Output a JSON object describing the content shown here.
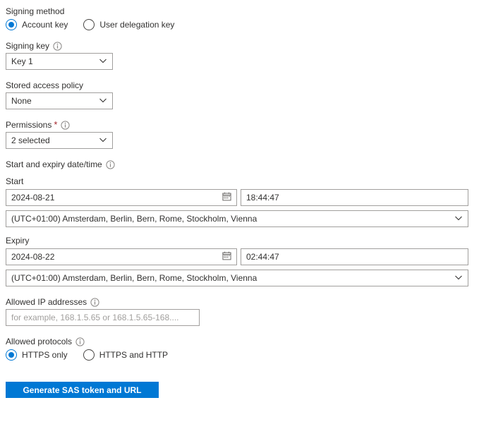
{
  "form": {
    "signing_method": {
      "label": "Signing method",
      "options": [
        {
          "label": "Account key",
          "selected": true
        },
        {
          "label": "User delegation key",
          "selected": false
        }
      ]
    },
    "signing_key": {
      "label": "Signing key",
      "value": "Key 1",
      "has_info": true
    },
    "stored_access_policy": {
      "label": "Stored access policy",
      "value": "None",
      "has_info": false
    },
    "permissions": {
      "label": "Permissions",
      "required_marker": "*",
      "value": "2 selected",
      "has_info": true
    },
    "date_time": {
      "label": "Start and expiry date/time",
      "has_info": true,
      "start": {
        "label": "Start",
        "date": "2024-08-21",
        "time": "18:44:47",
        "timezone": "(UTC+01:00) Amsterdam, Berlin, Bern, Rome, Stockholm, Vienna"
      },
      "expiry": {
        "label": "Expiry",
        "date": "2024-08-22",
        "time": "02:44:47",
        "timezone": "(UTC+01:00) Amsterdam, Berlin, Bern, Rome, Stockholm, Vienna"
      }
    },
    "allowed_ip": {
      "label": "Allowed IP addresses",
      "placeholder": "for example, 168.1.5.65 or 168.1.5.65-168....",
      "value": "",
      "has_info": true
    },
    "allowed_protocols": {
      "label": "Allowed protocols",
      "has_info": true,
      "options": [
        {
          "label": "HTTPS only",
          "selected": true
        },
        {
          "label": "HTTPS and HTTP",
          "selected": false
        }
      ]
    },
    "submit": {
      "label": "Generate SAS token and URL"
    }
  },
  "colors": {
    "accent": "#0078d4",
    "required": "#a4262c",
    "border": "#a19f9d",
    "text": "#323130",
    "placeholder": "#a19f9d"
  },
  "icons": {
    "info": "info-icon",
    "chevron": "chevron-down-icon",
    "calendar": "calendar-icon"
  }
}
